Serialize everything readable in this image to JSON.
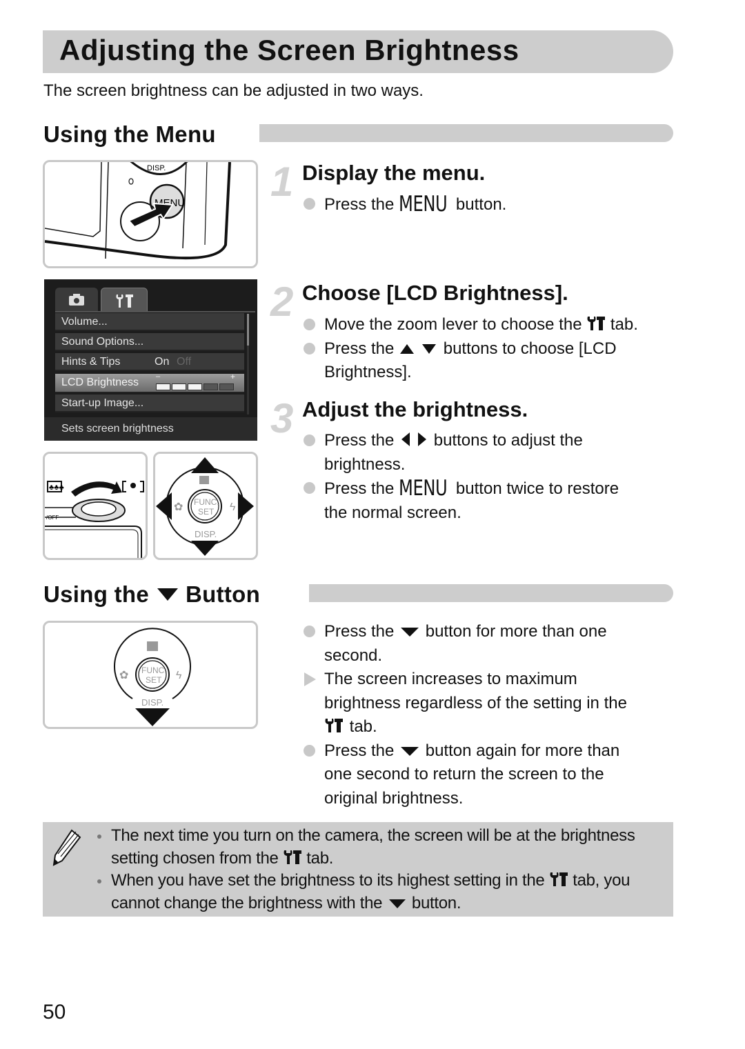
{
  "page": {
    "title": "Adjusting the Screen Brightness",
    "intro": "The screen brightness can be adjusted in two ways.",
    "page_number": "50"
  },
  "section_menu": {
    "heading": "Using the Menu",
    "steps": [
      {
        "number": "1",
        "title": "Display the menu.",
        "bullets": [
          {
            "type": "dot",
            "pre": "Press the ",
            "icon": "menu-button",
            "icon_text": "MENU",
            "post": " button."
          }
        ]
      },
      {
        "number": "2",
        "title": "Choose [LCD Brightness].",
        "bullets": [
          {
            "type": "dot",
            "pre": "Move the zoom lever to choose the ",
            "icon": "wrench-tab",
            "post": " tab."
          },
          {
            "type": "dot",
            "pre": "Press the ",
            "icon": "up-down-arrows",
            "post": " buttons to choose [LCD",
            "line2": "Brightness]."
          }
        ]
      },
      {
        "number": "3",
        "title": "Adjust the brightness.",
        "bullets": [
          {
            "type": "dot",
            "pre": "Press the ",
            "icon": "left-right-arrows",
            "post": " buttons to adjust the",
            "line2": "brightness."
          },
          {
            "type": "dot",
            "pre": "Press the ",
            "icon": "menu-button",
            "icon_text": "MENU",
            "post": " button twice to restore",
            "line2": "the normal screen."
          }
        ]
      }
    ]
  },
  "lcd_menu": {
    "tabs": [
      "camera-tab",
      "settings-tab"
    ],
    "active_tab": "settings-tab",
    "items": [
      {
        "label": "Volume...",
        "value": ""
      },
      {
        "label": "Sound Options...",
        "value": ""
      },
      {
        "label": "Hints & Tips",
        "value_on": "On",
        "value_off": "Off"
      },
      {
        "label": "LCD Brightness",
        "selected": true,
        "level": 3,
        "level_max": 5,
        "minus": "–",
        "plus": "+"
      },
      {
        "label": "Start-up Image...",
        "value": ""
      }
    ],
    "footer": "Sets screen brightness"
  },
  "illustrations": {
    "menu_button_label": "MENU",
    "disp_label": "DISP.",
    "func_label": "FUNC.",
    "set_label": "SET",
    "off_label": "/OFF"
  },
  "section_down": {
    "heading_pre": "Using the",
    "heading_post": "Button",
    "bullets": [
      {
        "type": "dot",
        "pre": "Press the ",
        "icon": "down-arrow",
        "post": " button for more than one",
        "line2": "second."
      },
      {
        "type": "tri",
        "pre": "The screen increases to maximum",
        "line2": "brightness regardless of the setting in the",
        "line3_icon": "wrench-tab",
        "line3": " tab."
      },
      {
        "type": "dot",
        "pre": "Press the ",
        "icon": "down-arrow",
        "post": " button again for more than",
        "line2": "one second to return the screen to the",
        "line3": "original brightness."
      }
    ]
  },
  "notes": {
    "items": [
      {
        "line1": "The next time you turn on the camera, the screen will be at the brightness",
        "line2_pre": "setting chosen from the ",
        "line2_post": " tab."
      },
      {
        "line1_pre": "When you have set the brightness to its highest setting in the ",
        "line1_post": " tab, you",
        "line2_pre": "cannot change the brightness with the ",
        "line2_post": " button."
      }
    ]
  }
}
